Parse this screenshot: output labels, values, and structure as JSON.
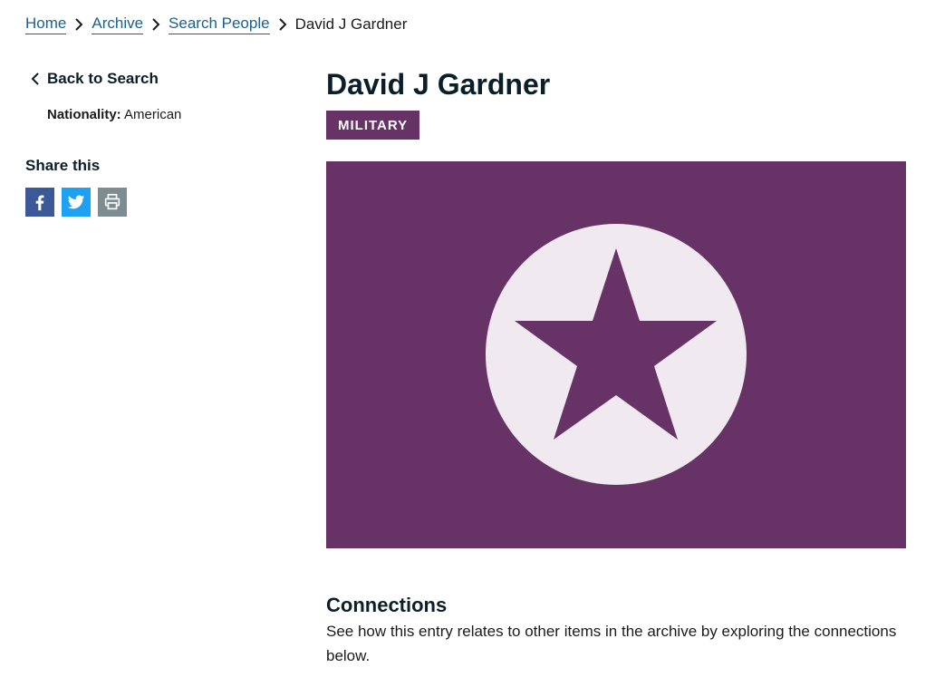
{
  "breadcrumb": {
    "items": [
      {
        "label": "Home"
      },
      {
        "label": "Archive"
      },
      {
        "label": "Search People"
      }
    ],
    "current": "David J Gardner"
  },
  "sidebar": {
    "back_label": "Back to Search",
    "nationality_label": "Nationality:",
    "nationality_value": "American",
    "share_title": "Share this",
    "share_icons": [
      "facebook-icon",
      "twitter-icon",
      "print-icon"
    ]
  },
  "person": {
    "name": "David J Gardner",
    "category": "MILITARY"
  },
  "hero": {
    "icon": "star-icon",
    "background_color": "#673366",
    "circle_color": "#f0e9f0"
  },
  "connections": {
    "title": "Connections",
    "description": "See how this entry relates to other items in the archive by exploring the connections below."
  }
}
